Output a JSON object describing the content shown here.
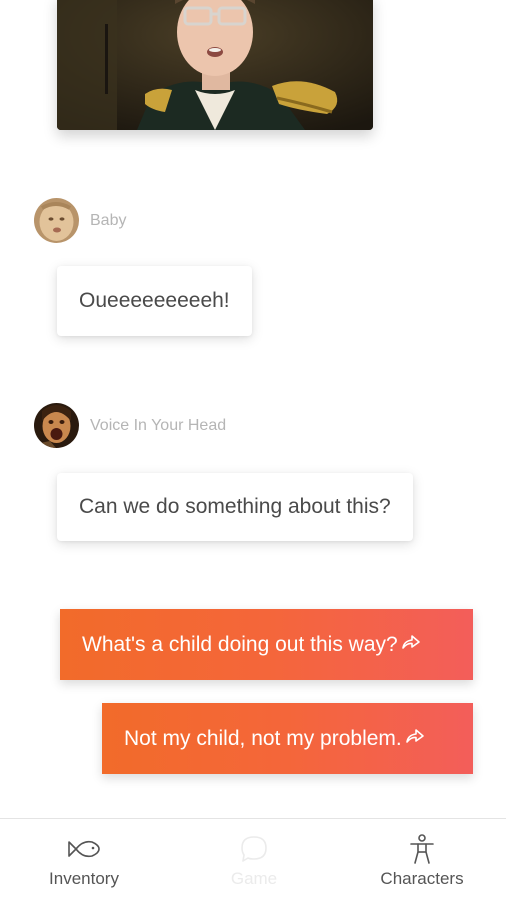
{
  "colors": {
    "choice_gradient_start": "#f26b2a",
    "choice_gradient_end": "#f35e5a",
    "speaker_name": "#b5b5b5",
    "bubble_text": "#4a4a4a",
    "tab_label": "#555555",
    "tab_label_disabled": "#ebebeb"
  },
  "chat": {
    "messages": [
      {
        "speaker": "Baby",
        "text": "Oueeeeeeeeeh!",
        "avatar_icon": "baby-avatar"
      },
      {
        "speaker": "Voice In Your Head",
        "text": "Can we do something about this?",
        "avatar_icon": "screaming-face-avatar"
      }
    ]
  },
  "choices": [
    {
      "label": "What's a child doing out this way?",
      "icon": "share-arrow-icon"
    },
    {
      "label": "Not my child, not my problem.",
      "icon": "share-arrow-icon"
    }
  ],
  "tabbar": {
    "tabs": [
      {
        "label": "Inventory",
        "icon": "fish-icon",
        "enabled": true
      },
      {
        "label": "Game",
        "icon": "chat-bubble-icon",
        "enabled": false
      },
      {
        "label": "Characters",
        "icon": "person-icon",
        "enabled": true
      }
    ]
  }
}
